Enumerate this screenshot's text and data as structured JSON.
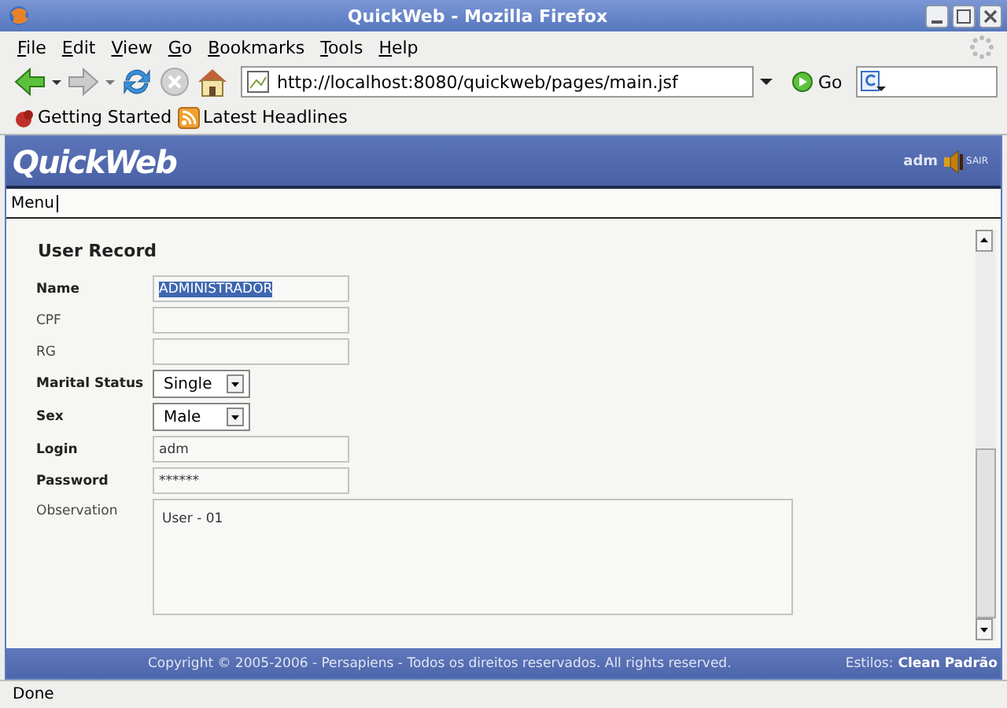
{
  "window": {
    "title": "QuickWeb - Mozilla Firefox"
  },
  "menu_bar": [
    {
      "accesskey": "F",
      "rest": "ile"
    },
    {
      "accesskey": "E",
      "rest": "dit"
    },
    {
      "accesskey": "V",
      "rest": "iew"
    },
    {
      "accesskey": "G",
      "rest": "o"
    },
    {
      "accesskey": "B",
      "rest": "ookmarks"
    },
    {
      "accesskey": "T",
      "rest": "ools"
    },
    {
      "accesskey": "H",
      "rest": "elp"
    }
  ],
  "toolbar": {
    "address": "http://localhost:8080/quickweb/pages/main.jsf",
    "go_label": "Go"
  },
  "bookmarks": [
    {
      "label": "Getting Started",
      "kind": "page"
    },
    {
      "label": "Latest Headlines",
      "kind": "feed"
    }
  ],
  "app": {
    "logo": "QuickWeb",
    "user": "adm",
    "exit_label": "SAIR",
    "menu": "Menu"
  },
  "form": {
    "title": "User Record",
    "fields": [
      {
        "label": "Name",
        "required": true,
        "kind": "text",
        "value": "ADMINISTRADOR",
        "text_selected": true
      },
      {
        "label": "CPF",
        "required": false,
        "kind": "text",
        "text_selected": false
      },
      {
        "label": "RG",
        "required": false,
        "kind": "text",
        "text_selected": false
      },
      {
        "label": "Marital Status",
        "required": true,
        "kind": "select",
        "value": "Single",
        "text_selected": false
      },
      {
        "label": "Sex",
        "required": true,
        "kind": "select",
        "value": "Male",
        "text_selected": false
      },
      {
        "label": "Login",
        "required": true,
        "kind": "text",
        "value": "adm",
        "text_selected": false
      },
      {
        "label": "Password",
        "required": true,
        "kind": "password",
        "value": "******",
        "text_selected": false
      },
      {
        "label": "Observation",
        "required": false,
        "kind": "textarea",
        "value": "User - 01",
        "text_selected": false
      }
    ]
  },
  "footer": {
    "copyright": "Copyright © 2005-2006 - Persapiens - Todos os direitos reservados. All rights reserved.",
    "styles_label": "Estilos:",
    "style_name": "Clean Padrão"
  },
  "status_bar": "Done"
}
